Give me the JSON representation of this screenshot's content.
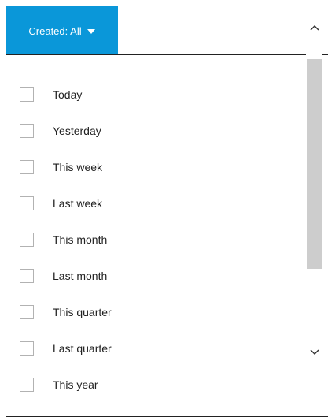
{
  "filter": {
    "label": "Created: All",
    "caret_icon": "caret-down-icon",
    "accent_color": "#0a97d9"
  },
  "options": [
    {
      "label": "Today",
      "checked": false
    },
    {
      "label": "Yesterday",
      "checked": false
    },
    {
      "label": "This week",
      "checked": false
    },
    {
      "label": "Last week",
      "checked": false
    },
    {
      "label": "This month",
      "checked": false
    },
    {
      "label": "Last month",
      "checked": false
    },
    {
      "label": "This quarter",
      "checked": false
    },
    {
      "label": "Last quarter",
      "checked": false
    },
    {
      "label": "This year",
      "checked": false
    }
  ],
  "scrollbar": {
    "up_icon": "chevron-up-icon",
    "down_icon": "chevron-down-icon",
    "thumb_color": "#cdcdcd"
  }
}
